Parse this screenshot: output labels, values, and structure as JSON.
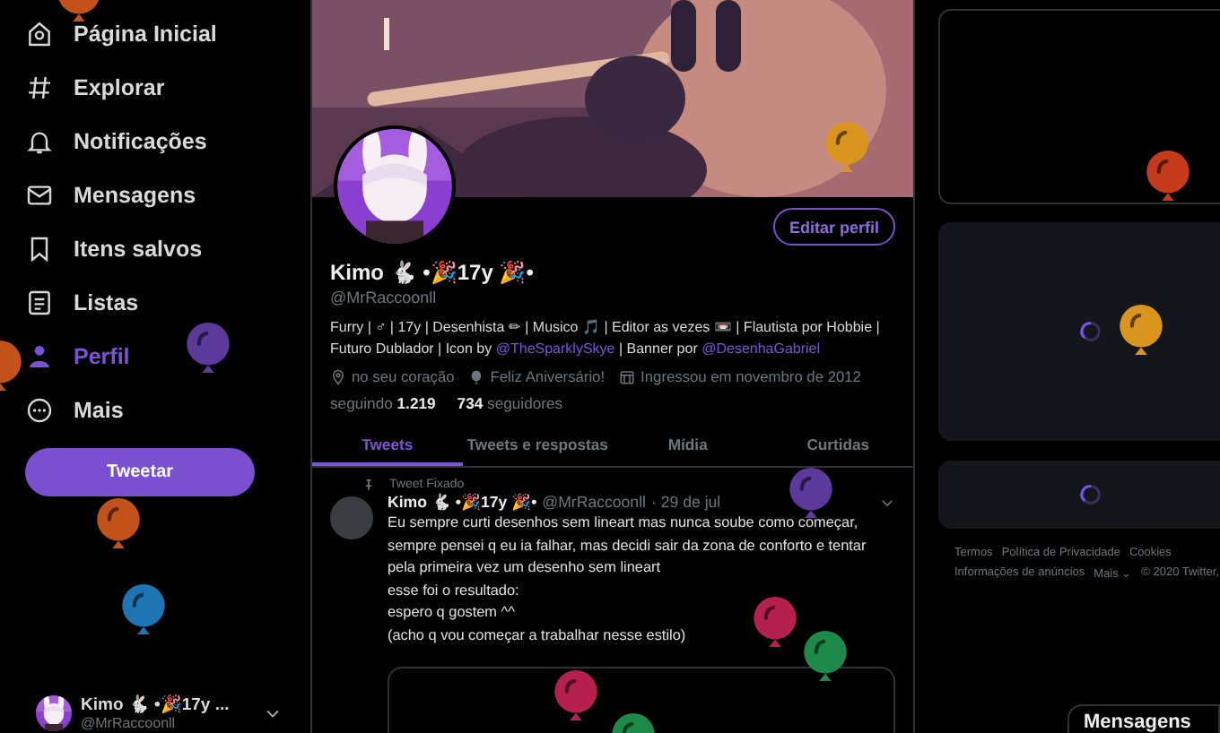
{
  "sidebar": {
    "items": [
      {
        "kind": "home",
        "label": "Página Inicial",
        "selected": false
      },
      {
        "kind": "hash",
        "label": "Explorar",
        "selected": false
      },
      {
        "kind": "bell",
        "label": "Notificações",
        "selected": false
      },
      {
        "kind": "mail",
        "label": "Mensagens",
        "selected": false
      },
      {
        "kind": "bookmark",
        "label": "Itens salvos",
        "selected": false
      },
      {
        "kind": "list",
        "label": "Listas",
        "selected": false
      },
      {
        "kind": "person",
        "label": "Perfil",
        "selected": true
      },
      {
        "kind": "more",
        "label": "Mais",
        "selected": false
      }
    ],
    "tweet_button": "Tweetar",
    "account": {
      "name": "Kimo 🐇 •🎉17y ...",
      "handle": "@MrRaccoonll"
    }
  },
  "profile": {
    "edit_button": "Editar perfil",
    "name": "Kimo 🐇 •🎉17y 🎉•",
    "handle": "@MrRaccoonll",
    "bio": [
      {
        "kind": "text",
        "text": "Furry | ♂ | 17y | Desenhista ✏ | Musico 🎵 | Editor as vezes 📼 | Flautista por Hobbie | Futuro Dublador | Icon by"
      },
      {
        "kind": "link",
        "text": "@TheSparklySkye"
      },
      {
        "kind": "text",
        "text": "| Banner por"
      },
      {
        "kind": "link",
        "text": "@DesenhaGabriel"
      }
    ],
    "meta": [
      {
        "kind": "location",
        "text": "no seu coração"
      },
      {
        "kind": "balloon",
        "text": "Feliz Aniversário!"
      },
      {
        "kind": "calendar",
        "text": "Ingressou em novembro de 2012"
      }
    ],
    "following": {
      "count": "1.219",
      "label": "seguindo"
    },
    "followers": {
      "count": "734",
      "label": "seguidores"
    }
  },
  "tabs": [
    {
      "label": "Tweets",
      "selected": true
    },
    {
      "label": "Tweets e respostas",
      "selected": false
    },
    {
      "label": "Mídia",
      "selected": false
    },
    {
      "label": "Curtidas",
      "selected": false
    }
  ],
  "pinned_tweet": {
    "label": "Tweet Fixado",
    "name": "Kimo 🐇 •🎉17y 🎉•",
    "handle": "@MrRaccoonll",
    "date": "· 29 de jul",
    "lines": [
      "Eu sempre curti desenhos sem lineart mas nunca soube como começar,",
      "sempre pensei q eu ia falhar, mas decidi sair da zona de conforto e tentar",
      "pela primeira vez um desenho sem lineart",
      "esse foi o resultado:",
      "espero q gostem ^^",
      "(acho q vou começar a trabalhar nesse estilo)"
    ]
  },
  "footer": {
    "links": [
      "Termos",
      "Política de Privacidade",
      "Cookies",
      "Informações de anúncios",
      "Mais ⌄"
    ],
    "copyright": "© 2020 Twitter,"
  },
  "messages_drawer": {
    "title": "Mensagens"
  },
  "balloons": [
    {
      "color": "#c2521a"
    },
    {
      "color": "#c2521a"
    },
    {
      "color": "#5b3a9c"
    },
    {
      "color": "#c2521a"
    },
    {
      "color": "#1d76b3"
    },
    {
      "color": "#5b3a9c"
    },
    {
      "color": "#b5204f"
    },
    {
      "color": "#1e8a4a"
    },
    {
      "color": "#b5204f"
    },
    {
      "color": "#1e8a4a"
    },
    {
      "color": "#d9951e"
    },
    {
      "color": "#c43a1a"
    },
    {
      "color": "#d9951e"
    }
  ]
}
